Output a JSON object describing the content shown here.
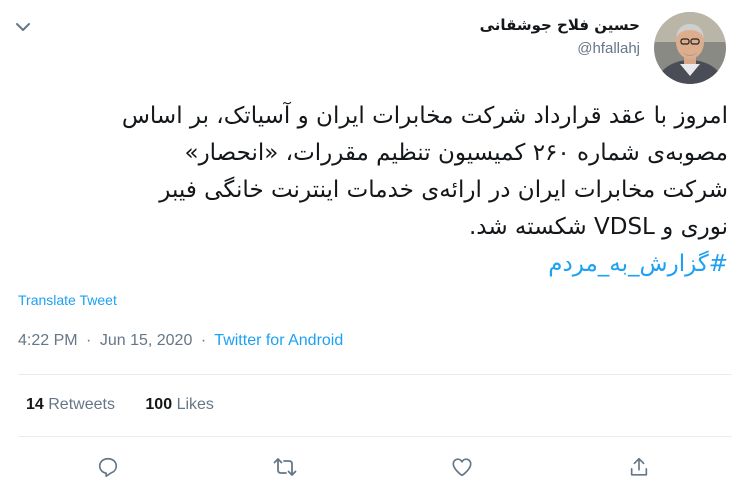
{
  "author": {
    "name": "حسین فلاح جوشقانی",
    "handle": "@hfallahj"
  },
  "tweet": {
    "lines": [
      "امروز با عقد قرارداد شرکت مخابرات ایران و آسیاتک، بر اساس",
      "مصوبه‌ی شماره ۲۶۰ کمیسیون تنظیم مقررات، «انحصار»",
      "شرکت مخابرات ایران در ارائه‌ی خدمات اینترنت خانگی فیبر",
      "نوری و VDSL شکسته شد."
    ],
    "hashtag": "#گزارش_به_مردم"
  },
  "translate_label": "Translate Tweet",
  "meta": {
    "time": "4:22 PM",
    "separator": "·",
    "date": "Jun 15, 2020",
    "source": "Twitter for Android"
  },
  "stats": {
    "retweets_count": "14",
    "retweets_label": "Retweets",
    "likes_count": "100",
    "likes_label": "Likes"
  },
  "colors": {
    "link": "#1da1f2",
    "muted": "#657786",
    "text": "#14171a",
    "divider": "#e6ecf0"
  },
  "icons": {
    "header": "chevron-down-icon",
    "actions": [
      "reply-icon",
      "retweet-icon",
      "like-icon",
      "share-icon"
    ]
  }
}
